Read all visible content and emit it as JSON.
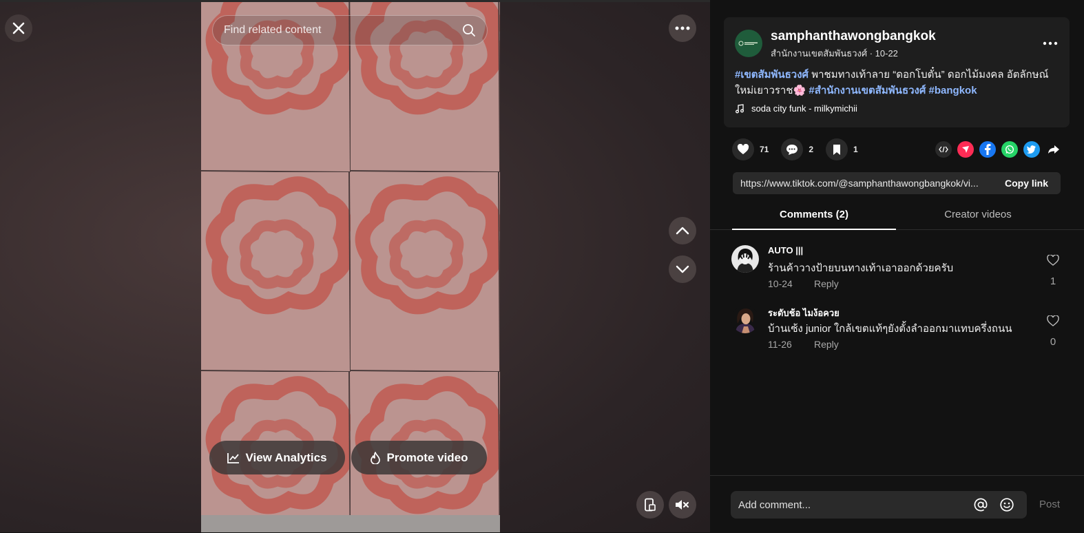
{
  "player": {
    "search_placeholder": "Find related content",
    "view_analytics_label": "View Analytics",
    "promote_video_label": "Promote video",
    "icons": {
      "close": "close-icon",
      "more": "more-horizontal-icon",
      "search": "search-icon",
      "up": "chevron-up-icon",
      "down": "chevron-down-icon",
      "pip": "picture-in-picture-icon",
      "mute": "muted-speaker-icon",
      "analytics": "line-chart-icon",
      "promote": "flame-icon"
    }
  },
  "post": {
    "username": "samphanthawongbangkok",
    "display_name": "สำนักงานเขตสัมพันธวงศ์",
    "separator": " · ",
    "date": "10-22",
    "caption_parts": [
      {
        "text": "#เขตสัมพันธวงศ์",
        "tag": true
      },
      {
        "text": " พาชมทางเท้าลาย “ดอกโบตั๋น” ดอกไม้มงคล อัตลักษณ์ใหม่เยาวราช🌸 ",
        "tag": false
      },
      {
        "text": "#สำนักงานเขตสัมพันธวงศ์",
        "tag": true
      },
      {
        "text": " ",
        "tag": false
      },
      {
        "text": "#bangkok",
        "tag": true
      }
    ],
    "music": "soda city funk - milkymichii",
    "likes": "71",
    "comments": "2",
    "saves": "1",
    "share_icons": [
      "embed-icon",
      "send-icon",
      "facebook-icon",
      "whatsapp-icon",
      "twitter-icon",
      "share-arrow-icon"
    ],
    "link": "https://www.tiktok.com/@samphanthawongbangkok/vi...",
    "copy_link_label": "Copy link"
  },
  "tabs": [
    {
      "label": "Comments (2)",
      "active": true
    },
    {
      "label": "Creator videos",
      "active": false
    }
  ],
  "comments": [
    {
      "name": "AUTO |||",
      "text": "ร้านค้าวางป้ายบนทางเท้าเอาออกด้วยครับ",
      "date": "10-24",
      "reply": "Reply",
      "likes": "1"
    },
    {
      "name": "ระดับช้อ ไมง้อควย",
      "text": "บ้านเซ้ง junior ใกล้เขตแท้ๆยังตั้งลำออกมาแทบครึ่งถนน",
      "date": "11-26",
      "reply": "Reply",
      "likes": "0"
    }
  ],
  "footer": {
    "placeholder": "Add comment...",
    "post_label": "Post"
  },
  "colors": {
    "panel_bg": "#121212",
    "card_bg": "#1e1e1e",
    "hashtag": "#8fb8ff",
    "send_red": "#fe2c55",
    "facebook": "#1877f2",
    "whatsapp": "#25d366",
    "twitter": "#1d9bf0"
  }
}
